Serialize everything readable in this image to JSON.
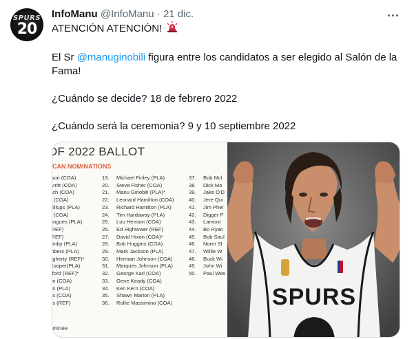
{
  "author": {
    "name": "InfoManu",
    "handle": "@InfoManu",
    "separator": "·",
    "date": "21 dic.",
    "avatar_text": "SPURS",
    "avatar_number": "20"
  },
  "tweet": {
    "line1": "ATENCIÓN ATENCIÓN!",
    "line2_prefix": "El Sr ",
    "line2_mention": "@manuginobili",
    "line2_suffix": " figura entre los candidatos a ser elegido al Salón de la Fama!",
    "line3": "¿Cuándo se decide? 18 de febrero 2022",
    "line4": "¿Cuándo será la ceremonia? 9 y 10 septiembre 2022"
  },
  "icons": {
    "more": "more-icon",
    "siren": "siren-emoji-icon"
  },
  "ballot": {
    "title": "OF 2022 BALLOT",
    "subtitle": "CAN NOMINATIONS",
    "footer": "ominee",
    "col1": [
      "rson (COA)",
      "Arritt (COA)",
      "ach (COA)",
      "s (COA)",
      "Billups (PLA)",
      "s (COA)",
      "Bogues (PLA)",
      "(REF)",
      "(REF)",
      "amby (PLA)",
      "mbers (PLA)",
      "agherty (REF)*",
      "Cooper(PLA)",
      "vford (REF)*",
      "an (COA)",
      "on (PLA)",
      "ns (COA)",
      "ns (REF)"
    ],
    "col2": [
      {
        "n": "19.",
        "t": "Michael Finley (PLA)"
      },
      {
        "n": "20.",
        "t": "Steve Fisher (COA)"
      },
      {
        "n": "21.",
        "t": "Manu Ginobili (PLA)*"
      },
      {
        "n": "22.",
        "t": "Leonard Hamilton (COA)"
      },
      {
        "n": "23.",
        "t": "Richard Hamilton (PLA)"
      },
      {
        "n": "24.",
        "t": "Tim Hardaway (PLA)"
      },
      {
        "n": "25.",
        "t": "Lou Henson (COA)"
      },
      {
        "n": "26.",
        "t": "Ed Hightower (REF)"
      },
      {
        "n": "27.",
        "t": "David Hixon (COA)*"
      },
      {
        "n": "28.",
        "t": "Bob Huggins (COA)"
      },
      {
        "n": "29.",
        "t": "Mark Jackson (PLA)"
      },
      {
        "n": "30.",
        "t": "Herman Johnson (COA)"
      },
      {
        "n": "31.",
        "t": "Marques Johnson (PLA)"
      },
      {
        "n": "32.",
        "t": "George Karl (COA)"
      },
      {
        "n": "33.",
        "t": "Gene Keady (COA)"
      },
      {
        "n": "34.",
        "t": "Ken Kern (COA)"
      },
      {
        "n": "35.",
        "t": "Shawn Marion (PLA)"
      },
      {
        "n": "36.",
        "t": "Rollie Massimino (COA)"
      }
    ],
    "col3": [
      {
        "n": "37.",
        "t": "Bob Mcl"
      },
      {
        "n": "38.",
        "t": "Dick Mo"
      },
      {
        "n": "39.",
        "t": "Jake O'D"
      },
      {
        "n": "40.",
        "t": "Jere Qui"
      },
      {
        "n": "41.",
        "t": "Jim Phel"
      },
      {
        "n": "42.",
        "t": "Digger P"
      },
      {
        "n": "43.",
        "t": "Lamont"
      },
      {
        "n": "44.",
        "t": "Bo Ryan"
      },
      {
        "n": "45.",
        "t": "Bob Saul"
      },
      {
        "n": "46.",
        "t": "Norm Sl"
      },
      {
        "n": "47.",
        "t": "Willie W"
      },
      {
        "n": "48.",
        "t": "Buck Wi"
      },
      {
        "n": "49.",
        "t": "John Wi"
      },
      {
        "n": "50.",
        "t": "Paul Wes"
      }
    ]
  },
  "photo": {
    "jersey_text": "SPURS",
    "colors": {
      "background": "#6b6b6b",
      "jersey": "#f3f3f1",
      "skin": "#c98f6c",
      "hair": "#2a1d15"
    }
  }
}
